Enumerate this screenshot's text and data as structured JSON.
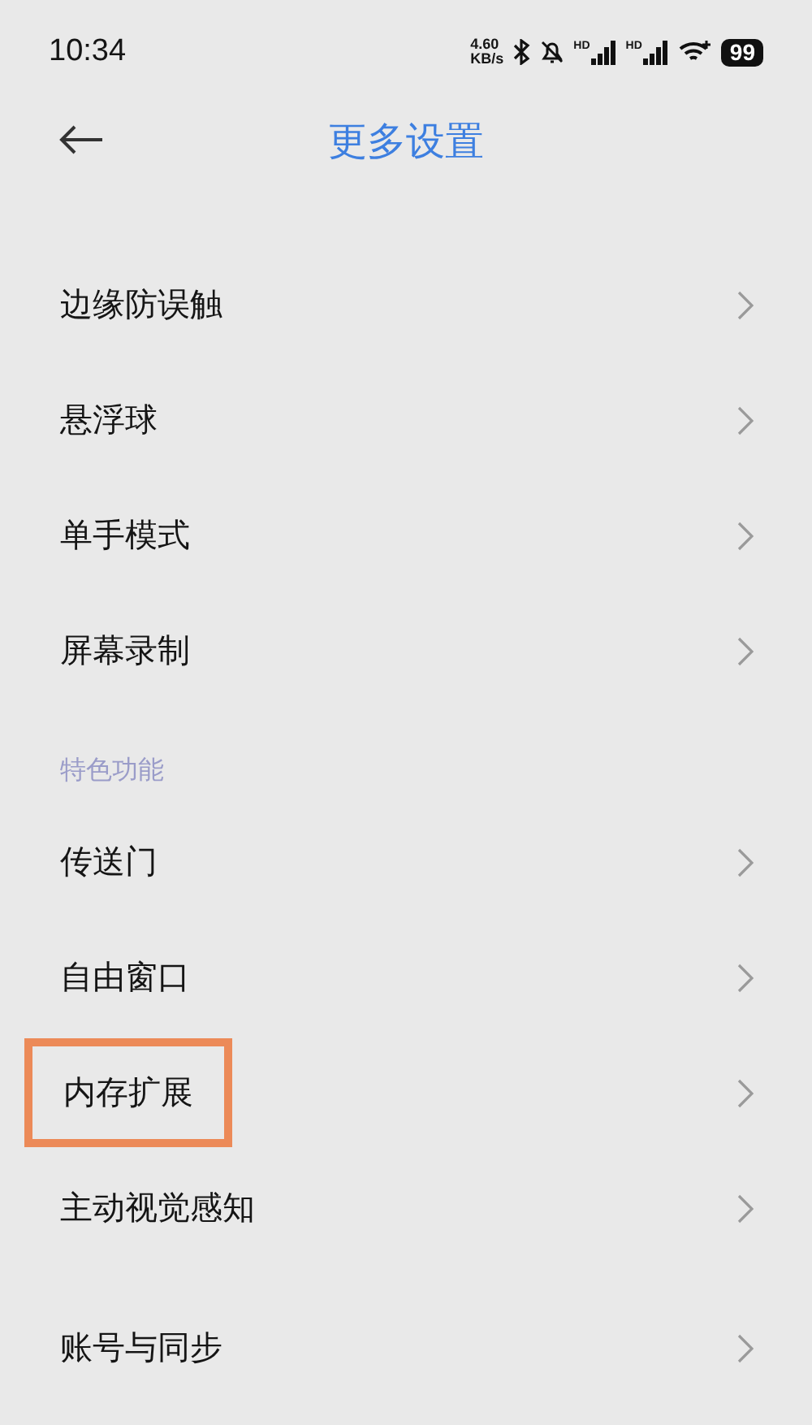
{
  "status_bar": {
    "time": "10:34",
    "speed_value": "4.60",
    "speed_unit": "KB/s",
    "signal_labels": [
      "HD",
      "HD"
    ],
    "battery": "99"
  },
  "header": {
    "title": "更多设置"
  },
  "sections": [
    {
      "items": [
        {
          "label": "边缘防误触",
          "highlighted": false
        },
        {
          "label": "悬浮球",
          "highlighted": false
        },
        {
          "label": "单手模式",
          "highlighted": false
        },
        {
          "label": "屏幕录制",
          "highlighted": false
        }
      ]
    },
    {
      "title": "特色功能",
      "items": [
        {
          "label": "传送门",
          "highlighted": false
        },
        {
          "label": "自由窗口",
          "highlighted": false
        },
        {
          "label": "内存扩展",
          "highlighted": true
        },
        {
          "label": "主动视觉感知",
          "highlighted": false
        }
      ]
    },
    {
      "items": [
        {
          "label": "账号与同步",
          "highlighted": false
        }
      ]
    }
  ]
}
